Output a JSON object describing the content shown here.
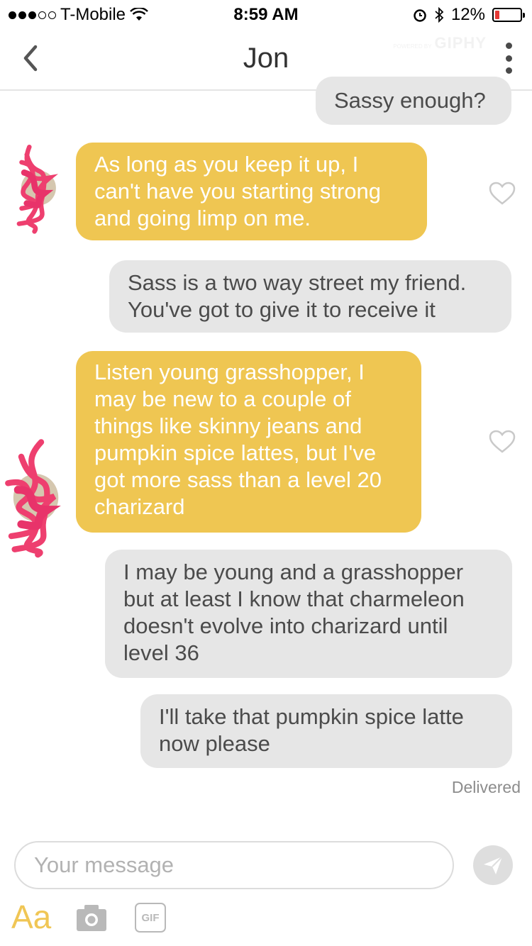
{
  "status_bar": {
    "carrier": "T-Mobile",
    "time": "8:59 AM",
    "battery": "12%"
  },
  "header": {
    "title": "Jon",
    "giphy_label": "GIPHY",
    "giphy_powered": "POWERED BY"
  },
  "messages": [
    {
      "side": "out",
      "text": "Sassy enough?"
    },
    {
      "side": "in",
      "text": "As long as you keep it up, I can't have you starting strong and going limp on me."
    },
    {
      "side": "out",
      "text": "Sass is a two way street my friend. You've got to give it to receive it"
    },
    {
      "side": "in",
      "text": "Listen young grasshopper, I may be new to a couple of things like skinny jeans and pumpkin spice lattes, but I've got more sass than a level 20 charizard"
    },
    {
      "side": "out",
      "text": "I may be young and a grasshopper but at least I know that charmeleon doesn't evolve into charizard until level 36"
    },
    {
      "side": "out",
      "text": "I'll take that pumpkin spice latte now please"
    }
  ],
  "delivered_label": "Delivered",
  "composer": {
    "placeholder": "Your message",
    "text_format_label": "Aa",
    "gif_label": "GIF"
  },
  "colors": {
    "incoming_bubble": "#efc652",
    "outgoing_bubble": "#e6e6e6",
    "accent": "#f0c655"
  }
}
